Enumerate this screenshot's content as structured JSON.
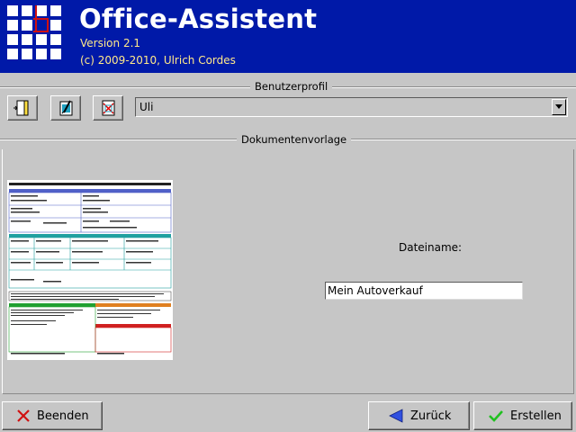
{
  "header": {
    "title": "Office-Assistent",
    "version": "Version 2.1",
    "copyright": "(c) 2009-2010, Ulrich Cordes",
    "background": "#0019a8",
    "text_accent": "#ffe98a"
  },
  "profile": {
    "section_title": "Benutzerprofil",
    "toolbar": [
      {
        "icon": "new-document-icon"
      },
      {
        "icon": "edit-document-icon"
      },
      {
        "icon": "delete-document-icon"
      }
    ],
    "selected": "Uli"
  },
  "document": {
    "section_title": "Dokumentenvorlage",
    "filename_label": "Dateiname:",
    "filename_value": "Mein Autoverkauf"
  },
  "buttons": {
    "quit": "Beenden",
    "back": "Zurück",
    "create": "Erstellen"
  }
}
